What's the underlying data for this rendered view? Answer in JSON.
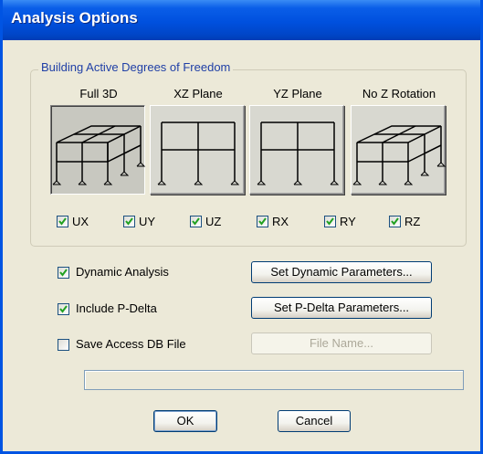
{
  "window": {
    "title": "Analysis Options"
  },
  "group": {
    "legend": "Building Active Degrees of Freedom",
    "presets": [
      {
        "label": "Full 3D",
        "icon": "full-3d-frame-icon"
      },
      {
        "label": "XZ Plane",
        "icon": "xz-plane-frame-icon"
      },
      {
        "label": "YZ Plane",
        "icon": "yz-plane-frame-icon"
      },
      {
        "label": "No Z Rotation",
        "icon": "no-z-rotation-frame-icon"
      }
    ],
    "dofs": [
      {
        "label": "UX",
        "checked": true
      },
      {
        "label": "UY",
        "checked": true
      },
      {
        "label": "UZ",
        "checked": true
      },
      {
        "label": "RX",
        "checked": true
      },
      {
        "label": "RY",
        "checked": true
      },
      {
        "label": "RZ",
        "checked": true
      }
    ]
  },
  "options": {
    "dynamic": {
      "label": "Dynamic Analysis",
      "checked": true,
      "button": "Set Dynamic Parameters..."
    },
    "pdelta": {
      "label": "Include P-Delta",
      "checked": true,
      "button": "Set P-Delta Parameters..."
    },
    "access": {
      "label": "Save Access DB File",
      "checked": false,
      "button": "File Name..."
    }
  },
  "path_field": {
    "value": ""
  },
  "buttons": {
    "ok": "OK",
    "cancel": "Cancel"
  }
}
